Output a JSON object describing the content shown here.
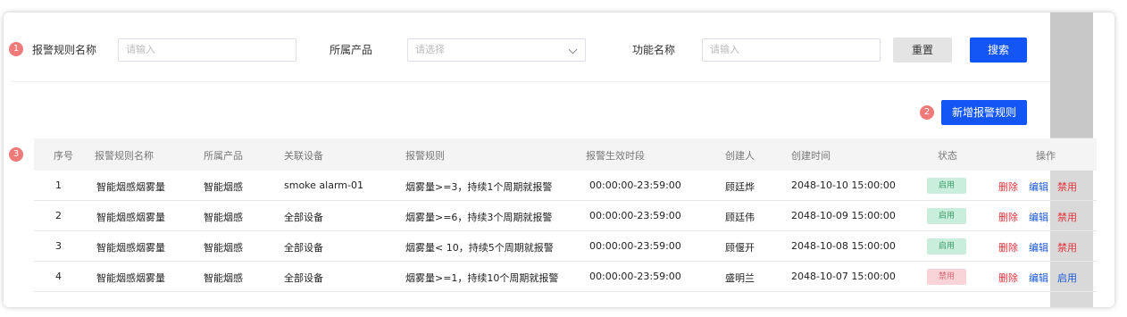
{
  "badges": [
    "1",
    "2",
    "3"
  ],
  "filters": {
    "rule_name_label": "报警规则名称",
    "rule_name_placeholder": "请输入",
    "product_label": "所属产品",
    "product_placeholder": "请选择",
    "function_label": "功能名称",
    "function_placeholder": "请输入",
    "reset_label": "重置",
    "search_label": "搜索"
  },
  "toolbar": {
    "add_rule_label": "新增报警规则"
  },
  "table": {
    "headers": [
      "序号",
      "报警规则名称",
      "所属产品",
      "关联设备",
      "报警规则",
      "报警生效时段",
      "创建人",
      "创建时间",
      "状态",
      "操作"
    ],
    "rows": [
      {
        "index": "1",
        "name": "智能烟感烟雾量",
        "product": "智能烟感",
        "device": "smoke alarm-01",
        "rule": "烟雾量>=3，持续1个周期就报警",
        "period": "00:00:00-23:59:00",
        "creator": "顾廷烨",
        "created": "2048-10-10 15:00:00",
        "status": "启用",
        "status_on": true,
        "actions": [
          "删除",
          "编辑",
          "禁用"
        ]
      },
      {
        "index": "2",
        "name": "智能烟感烟雾量",
        "product": "智能烟感",
        "device": "全部设备",
        "rule": "烟雾量>=6，持续3个周期就报警",
        "period": "00:00:00-23:59:00",
        "creator": "顾廷伟",
        "created": "2048-10-09 15:00:00",
        "status": "启用",
        "status_on": true,
        "actions": [
          "删除",
          "编辑",
          "禁用"
        ]
      },
      {
        "index": "3",
        "name": "智能烟感烟雾量",
        "product": "智能烟感",
        "device": "全部设备",
        "rule": "烟雾量< 10，持续5个周期就报警",
        "period": "00:00:00-23:59:00",
        "creator": "顾偃开",
        "created": "2048-10-08 15:00:00",
        "status": "启用",
        "status_on": true,
        "actions": [
          "删除",
          "编辑",
          "禁用"
        ]
      },
      {
        "index": "4",
        "name": "智能烟感烟雾量",
        "product": "智能烟感",
        "device": "全部设备",
        "rule": "烟雾量>=1，持续10个周期就报警",
        "period": "00:00:00-23:59:00",
        "creator": "盛明兰",
        "created": "2048-10-07 15:00:00",
        "status": "禁用",
        "status_on": false,
        "actions": [
          "删除",
          "编辑",
          "启用"
        ]
      }
    ]
  },
  "colors": {
    "primary": "#1356f5",
    "danger": "#e5333c",
    "link": "#1a57d6",
    "badge": "#f07a7a"
  }
}
